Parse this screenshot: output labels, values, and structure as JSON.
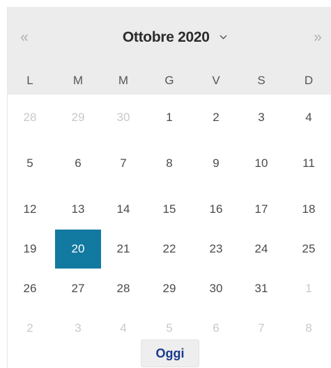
{
  "calendar": {
    "prev_label": "«",
    "next_label": "»",
    "month_year": "Ottobre 2020",
    "weekdays": [
      "L",
      "M",
      "M",
      "G",
      "V",
      "S",
      "D"
    ],
    "weeks": [
      [
        {
          "d": "28",
          "other": true
        },
        {
          "d": "29",
          "other": true
        },
        {
          "d": "30",
          "other": true
        },
        {
          "d": "1"
        },
        {
          "d": "2"
        },
        {
          "d": "3"
        },
        {
          "d": "4"
        }
      ],
      [
        {
          "d": "5"
        },
        {
          "d": "6"
        },
        {
          "d": "7"
        },
        {
          "d": "8"
        },
        {
          "d": "9"
        },
        {
          "d": "10"
        },
        {
          "d": "11"
        }
      ],
      [
        {
          "d": "12"
        },
        {
          "d": "13"
        },
        {
          "d": "14"
        },
        {
          "d": "15"
        },
        {
          "d": "16"
        },
        {
          "d": "17"
        },
        {
          "d": "18"
        }
      ],
      [
        {
          "d": "19"
        },
        {
          "d": "20",
          "selected": true
        },
        {
          "d": "21"
        },
        {
          "d": "22"
        },
        {
          "d": "23"
        },
        {
          "d": "24"
        },
        {
          "d": "25"
        }
      ],
      [
        {
          "d": "26"
        },
        {
          "d": "27"
        },
        {
          "d": "28"
        },
        {
          "d": "29"
        },
        {
          "d": "30"
        },
        {
          "d": "31"
        },
        {
          "d": "1",
          "other": true
        }
      ],
      [
        {
          "d": "2",
          "other": true
        },
        {
          "d": "3",
          "other": true
        },
        {
          "d": "4",
          "other": true
        },
        {
          "d": "5",
          "other": true
        },
        {
          "d": "6",
          "other": true
        },
        {
          "d": "7",
          "other": true
        },
        {
          "d": "8",
          "other": true
        }
      ]
    ],
    "today_label": "Oggi"
  },
  "colors": {
    "header_bg": "#ececec",
    "selected_bg": "#1279a1",
    "today_text": "#1a3a8c"
  },
  "icons": {
    "prev": "double-chevron-left-icon",
    "next": "double-chevron-right-icon",
    "month_dropdown": "chevron-down-icon"
  }
}
